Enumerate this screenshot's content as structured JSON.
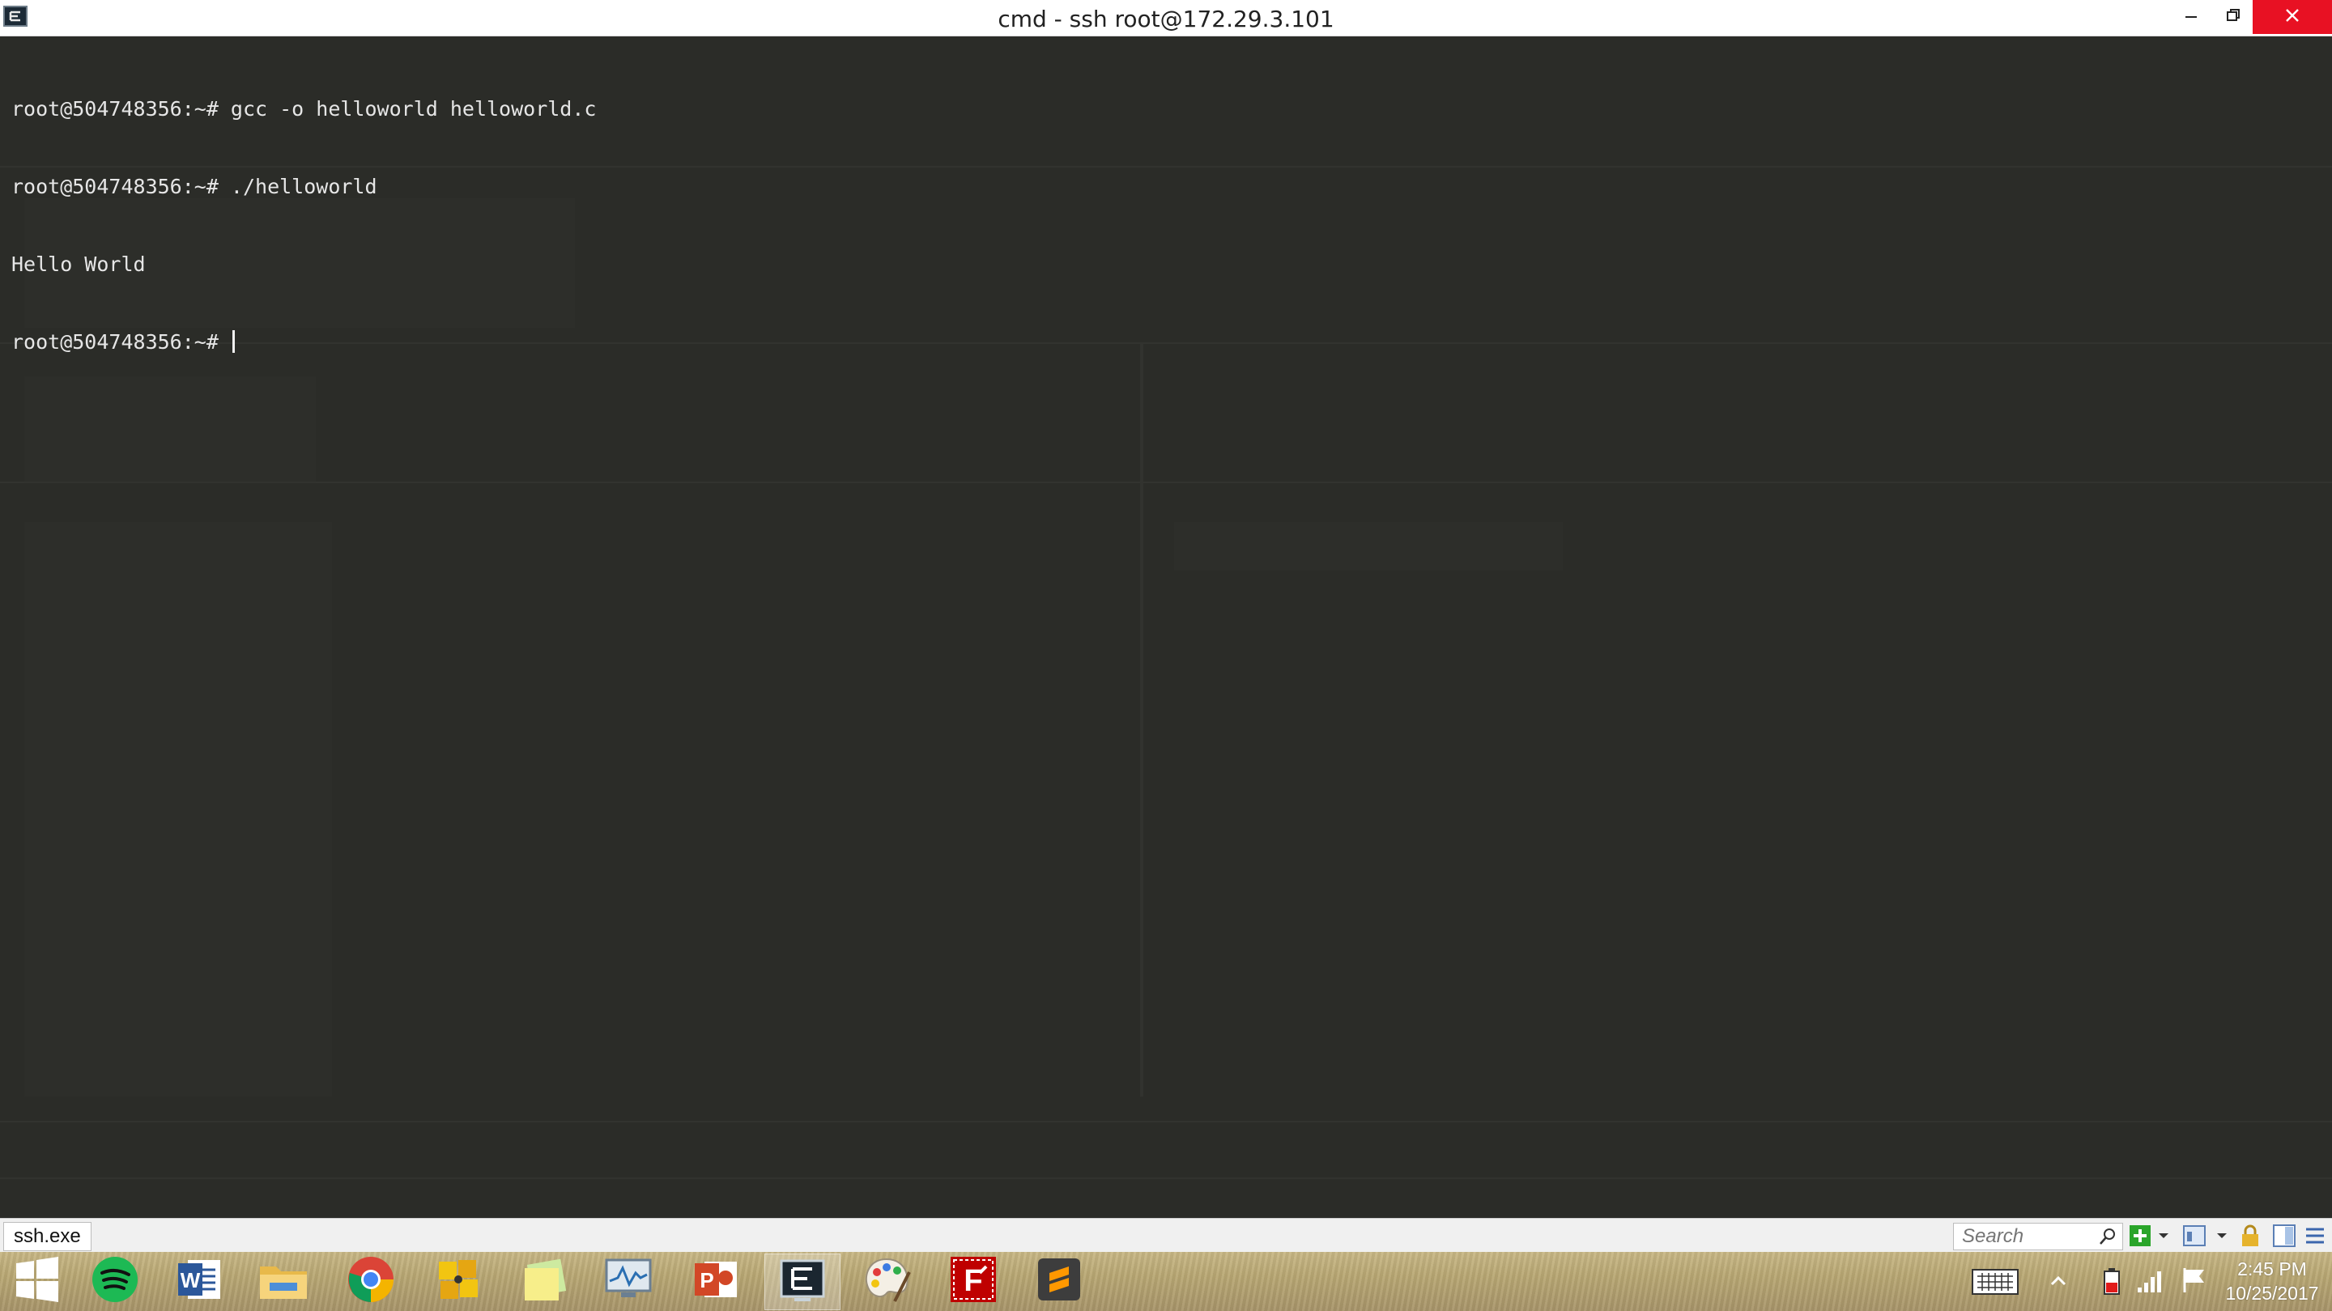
{
  "window": {
    "title": "cmd - ssh  root@172.29.3.101",
    "app_icon": "console-icon",
    "controls": [
      "minimize-icon",
      "restore-icon",
      "close-icon"
    ]
  },
  "terminal": {
    "lines": [
      "root@504748356:~# gcc -o helloworld helloworld.c",
      "root@504748356:~# ./helloworld",
      "Hello World",
      "root@504748356:~# "
    ],
    "cursor_visible": true,
    "background_color": "#2b2c28",
    "text_color": "#e6e6e6"
  },
  "statusbar": {
    "tab_label": "ssh.exe",
    "search_placeholder": "Search",
    "icons": [
      "search-icon",
      "add-icon",
      "dropdown-icon",
      "view-icon",
      "dropdown-icon",
      "lock-icon",
      "layout-icon",
      "menu-icon"
    ]
  },
  "taskbar": {
    "items": [
      {
        "name": "start-button",
        "icon": "windows-icon"
      },
      {
        "name": "spotify",
        "icon": "spotify-icon"
      },
      {
        "name": "word",
        "icon": "word-icon"
      },
      {
        "name": "file-explorer",
        "icon": "folder-icon"
      },
      {
        "name": "chrome",
        "icon": "chrome-icon"
      },
      {
        "name": "puzzle-app",
        "icon": "puzzle-icon"
      },
      {
        "name": "sticky-notes",
        "icon": "sticky-notes-icon"
      },
      {
        "name": "resource-monitor",
        "icon": "monitor-icon"
      },
      {
        "name": "powerpoint",
        "icon": "powerpoint-icon"
      },
      {
        "name": "console",
        "icon": "console-icon",
        "active": true
      },
      {
        "name": "paint",
        "icon": "palette-icon"
      },
      {
        "name": "filezilla",
        "icon": "filezilla-icon"
      },
      {
        "name": "sublime-text",
        "icon": "sublime-icon"
      }
    ],
    "tray_icons": [
      "keyboard-icon",
      "chevron-up-icon",
      "battery-icon",
      "signal-icon",
      "flag-icon"
    ],
    "clock": {
      "time": "2:45 PM",
      "date": "10/25/2017"
    }
  }
}
